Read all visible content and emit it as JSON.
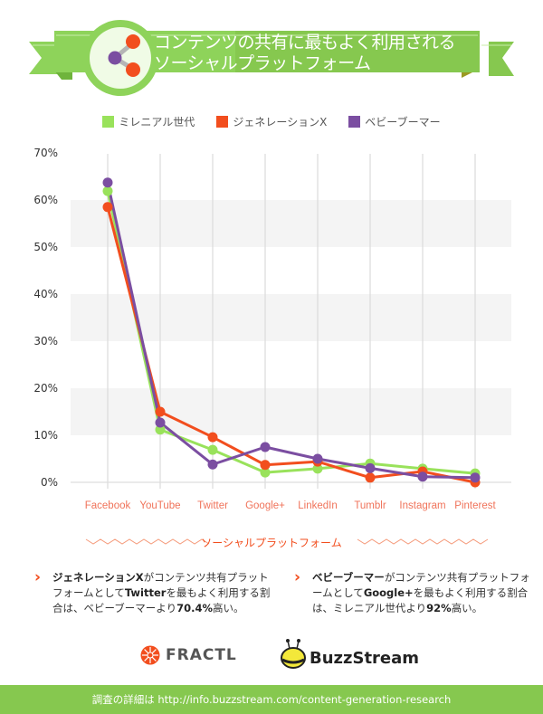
{
  "header": {
    "title_line1": "コンテンツの共有に最もよく利用される",
    "title_line2": "ソーシャルプラットフォーム",
    "icon": "share-icon"
  },
  "colors": {
    "millennial": "#99e25b",
    "genx": "#f24e1e",
    "boomer": "#7b4ea1",
    "banner_green": "#8ed35a",
    "accent": "#f24e1e",
    "footer_green": "#86c84f"
  },
  "chart_data": {
    "type": "line",
    "title": "コンテンツの共有に最もよく利用されるソーシャルプラットフォーム",
    "xlabel": "ソーシャルプラットフォーム",
    "ylabel": "",
    "categories": [
      "Facebook",
      "YouTube",
      "Twitter",
      "Google+",
      "LinkedIn",
      "Tumblr",
      "Instagram",
      "Pinterest"
    ],
    "yticks": [
      "0%",
      "10%",
      "20%",
      "30%",
      "40%",
      "50%",
      "60%",
      "70%"
    ],
    "ylim": [
      0,
      70
    ],
    "grid": "vertical lines per category, alternating horizontal bands",
    "legend_position": "top-center",
    "series": [
      {
        "name": "ミレニアル世代",
        "key": "millennial",
        "values": [
          61.9,
          11.2,
          6.9,
          2.1,
          2.9,
          4.0,
          2.9,
          1.9
        ]
      },
      {
        "name": "ジェネレーションX",
        "key": "genx",
        "values": [
          58.5,
          15.0,
          9.6,
          3.7,
          4.4,
          1.0,
          2.3,
          0.0
        ]
      },
      {
        "name": "ベビーブーマー",
        "key": "boomer",
        "values": [
          63.7,
          12.7,
          3.8,
          7.5,
          5.0,
          3.0,
          1.2,
          1.0
        ]
      }
    ]
  },
  "notes": [
    {
      "bold": "ジェネレーションX",
      "text": "がコンテンツ共有プラットフォームとして",
      "bold2": "Twitter",
      "text2": "を最もよく利用する割合は、ベビーブーマーより",
      "bold3": "70.4%",
      "text3": "高い。"
    },
    {
      "bold": "ベビーブーマー",
      "text": "がコンテンツ共有プラットフォームとして",
      "bold2": "Google+",
      "text2": "を最もよく利用する割合は、ミレニアル世代より",
      "bold3": "92%",
      "text3": "高い。"
    }
  ],
  "logos": {
    "fractl": "FRACTL",
    "buzzstream": "BuzzStream"
  },
  "footer": {
    "text": "調査の詳細は http://info.buzzstream.com/content-generation-research"
  }
}
